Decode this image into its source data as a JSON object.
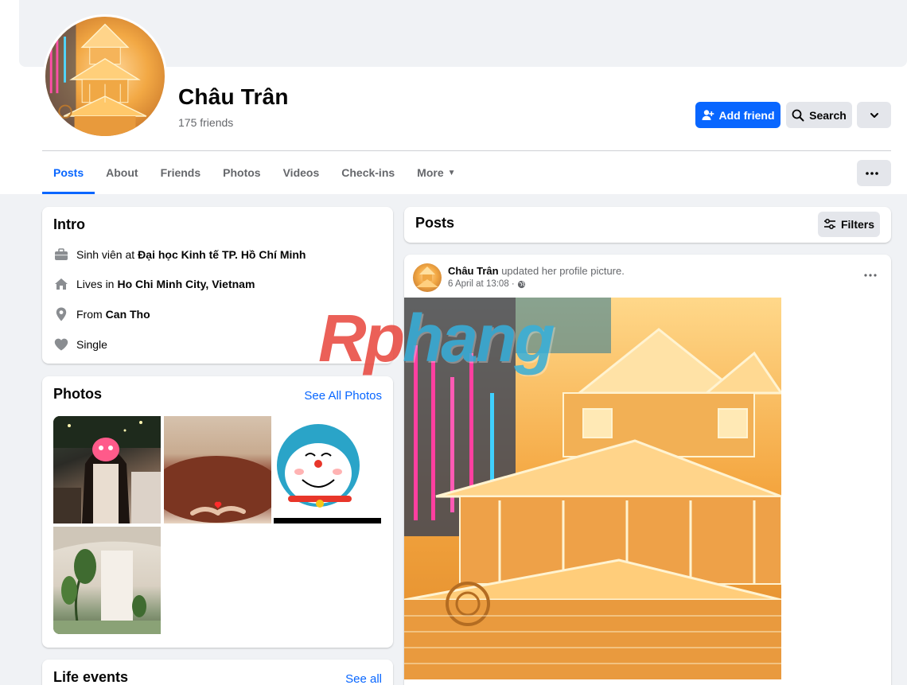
{
  "profile": {
    "name": "Châu Trân",
    "friends_count": "175 friends"
  },
  "actions": {
    "add_friend": "Add friend",
    "search": "Search"
  },
  "tabs": [
    {
      "label": "Posts",
      "active": true
    },
    {
      "label": "About",
      "active": false
    },
    {
      "label": "Friends",
      "active": false
    },
    {
      "label": "Photos",
      "active": false
    },
    {
      "label": "Videos",
      "active": false
    },
    {
      "label": "Check-ins",
      "active": false
    },
    {
      "label": "More",
      "active": false
    }
  ],
  "intro": {
    "title": "Intro",
    "items": [
      {
        "icon": "briefcase-icon",
        "prefix": "Sinh viên at",
        "value": "Đại học Kinh tế TP. Hồ Chí Minh"
      },
      {
        "icon": "home-icon",
        "prefix": "Lives in",
        "value": "Ho Chi Minh City, Vietnam"
      },
      {
        "icon": "location-pin-icon",
        "prefix": "From",
        "value": "Can Tho"
      },
      {
        "icon": "heart-icon",
        "prefix": "Single",
        "value": ""
      }
    ]
  },
  "photos": {
    "title": "Photos",
    "see_all": "See All Photos"
  },
  "life_events": {
    "title": "Life events",
    "see_all": "See all"
  },
  "posts": {
    "title": "Posts",
    "filters": "Filters",
    "items": [
      {
        "author": "Châu Trân",
        "action": "updated her profile picture.",
        "time": "6 April at 13:08 ·"
      }
    ]
  },
  "watermark": {
    "part1": "Rp",
    "part2": "hang"
  },
  "colors": {
    "accent": "#0866ff",
    "secondary_button": "#e4e6eb",
    "page_background": "#f0f2f5",
    "muted_text": "#65676b"
  }
}
